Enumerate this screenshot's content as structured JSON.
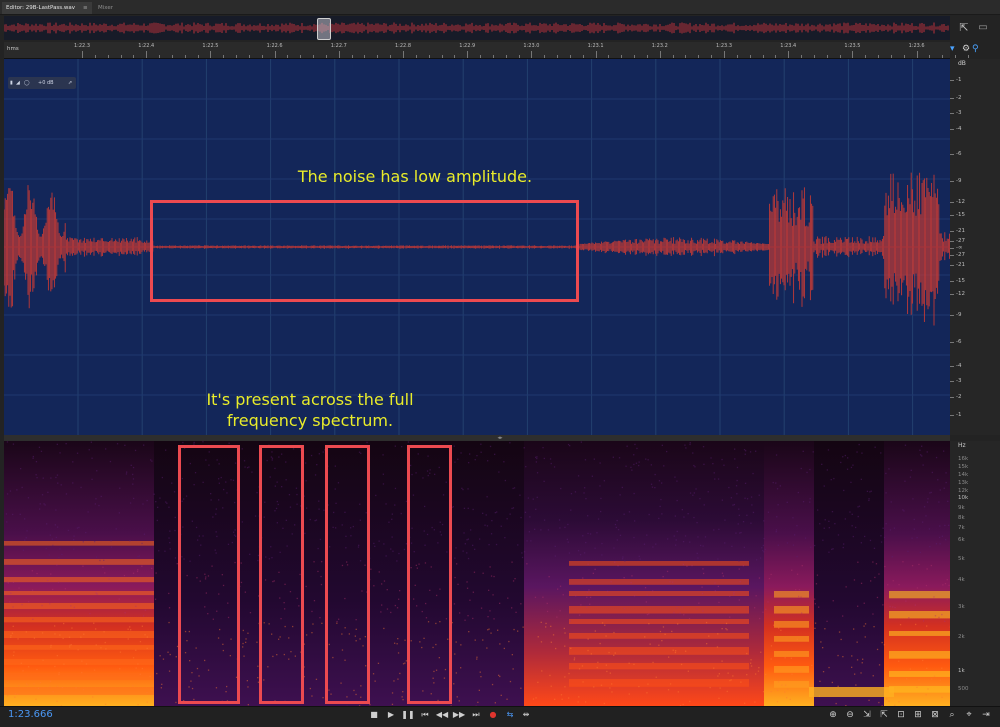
{
  "tabs": [
    {
      "label": "Editor: 29B-LastPass.wav",
      "menu_icon": "hamburger-menu-icon"
    },
    {
      "label": "Mixer"
    }
  ],
  "ruler": {
    "unit": "hms",
    "labels": [
      "1:22.3",
      "1:22.4",
      "1:22.5",
      "1:22.6",
      "1:22.7",
      "1:22.8",
      "1:22.9",
      "1:23.0",
      "1:23.1",
      "1:23.2",
      "1:23.3",
      "1:23.4",
      "1:23.5",
      "1:23.6"
    ]
  },
  "hud": {
    "gain": "+0 dB"
  },
  "amplitude_scale": {
    "unit": "dB",
    "labels": [
      "-1",
      "-2",
      "-3",
      "-4",
      "-6",
      "-9",
      "-12",
      "-15",
      "-21",
      "-27",
      "-∞",
      "-27",
      "-21",
      "-15",
      "-12",
      "-9",
      "-6",
      "-4",
      "-3",
      "-2",
      "-1"
    ]
  },
  "frequency_scale": {
    "unit": "Hz",
    "labels": [
      "16k",
      "15k",
      "14k",
      "13k",
      "12k",
      "10k",
      "9k",
      "8k",
      "7k",
      "6k",
      "5k",
      "4k",
      "3k",
      "2k",
      "1k",
      "500"
    ]
  },
  "annotations": {
    "amplitude_note": "The noise has low amplitude.",
    "spectrum_note_line1": "It's present across the full",
    "spectrum_note_line2": "frequency spectrum."
  },
  "status": {
    "timecode": "1:23.666"
  },
  "colors": {
    "waveform_bg": "#132659",
    "waveform": "#c23a36",
    "annotation_text": "#e9ec2a",
    "highlight_box": "#ec4a50",
    "timecode": "#4b98f5"
  }
}
